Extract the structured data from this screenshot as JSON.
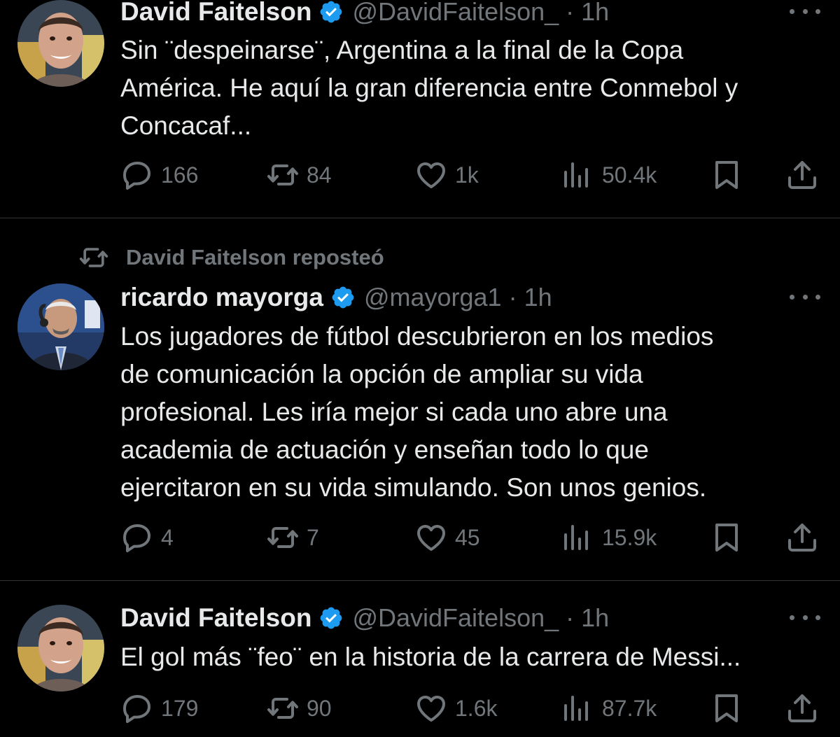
{
  "tweets": [
    {
      "name": "David Faitelson",
      "handle": "@DavidFaitelson_",
      "time": "1h",
      "text_lines": [
        "Sin  ¨despeinarse¨, Argentina a la final de la Copa",
        "América. He aquí la gran diferencia entre Conmebol y",
        "Concacaf..."
      ],
      "replies": "166",
      "reposts": "84",
      "likes": "1k",
      "views": "50.4k"
    },
    {
      "repost_label": "David Faitelson reposteó",
      "name": "ricardo mayorga",
      "handle": "@mayorga1",
      "time": "1h",
      "text_lines": [
        "Los jugadores de fútbol descubrieron en los medios",
        "de comunicación la opción de ampliar su vida",
        "profesional. Les iría mejor si cada uno abre una",
        "academia de actuación y enseñan todo lo que",
        "ejercitaron en su vida simulando. Son unos genios."
      ],
      "replies": "4",
      "reposts": "7",
      "likes": "45",
      "views": "15.9k"
    },
    {
      "name": "David Faitelson",
      "handle": "@DavidFaitelson_",
      "time": "1h",
      "text_lines": [
        "El gol más ¨feo¨ en la historia de la carrera de Messi..."
      ],
      "replies": "179",
      "reposts": "90",
      "likes": "1.6k",
      "views": "87.7k"
    }
  ],
  "separator": " · ",
  "colors": {
    "background": "#000000",
    "text": "#e7e9ea",
    "muted": "#71767b",
    "verified": "#1d9bf0",
    "divider": "#2f3336"
  },
  "icons": [
    "verified-badge-icon",
    "more-icon",
    "reply-icon",
    "repost-icon",
    "like-icon",
    "views-icon",
    "bookmark-icon",
    "share-icon"
  ]
}
